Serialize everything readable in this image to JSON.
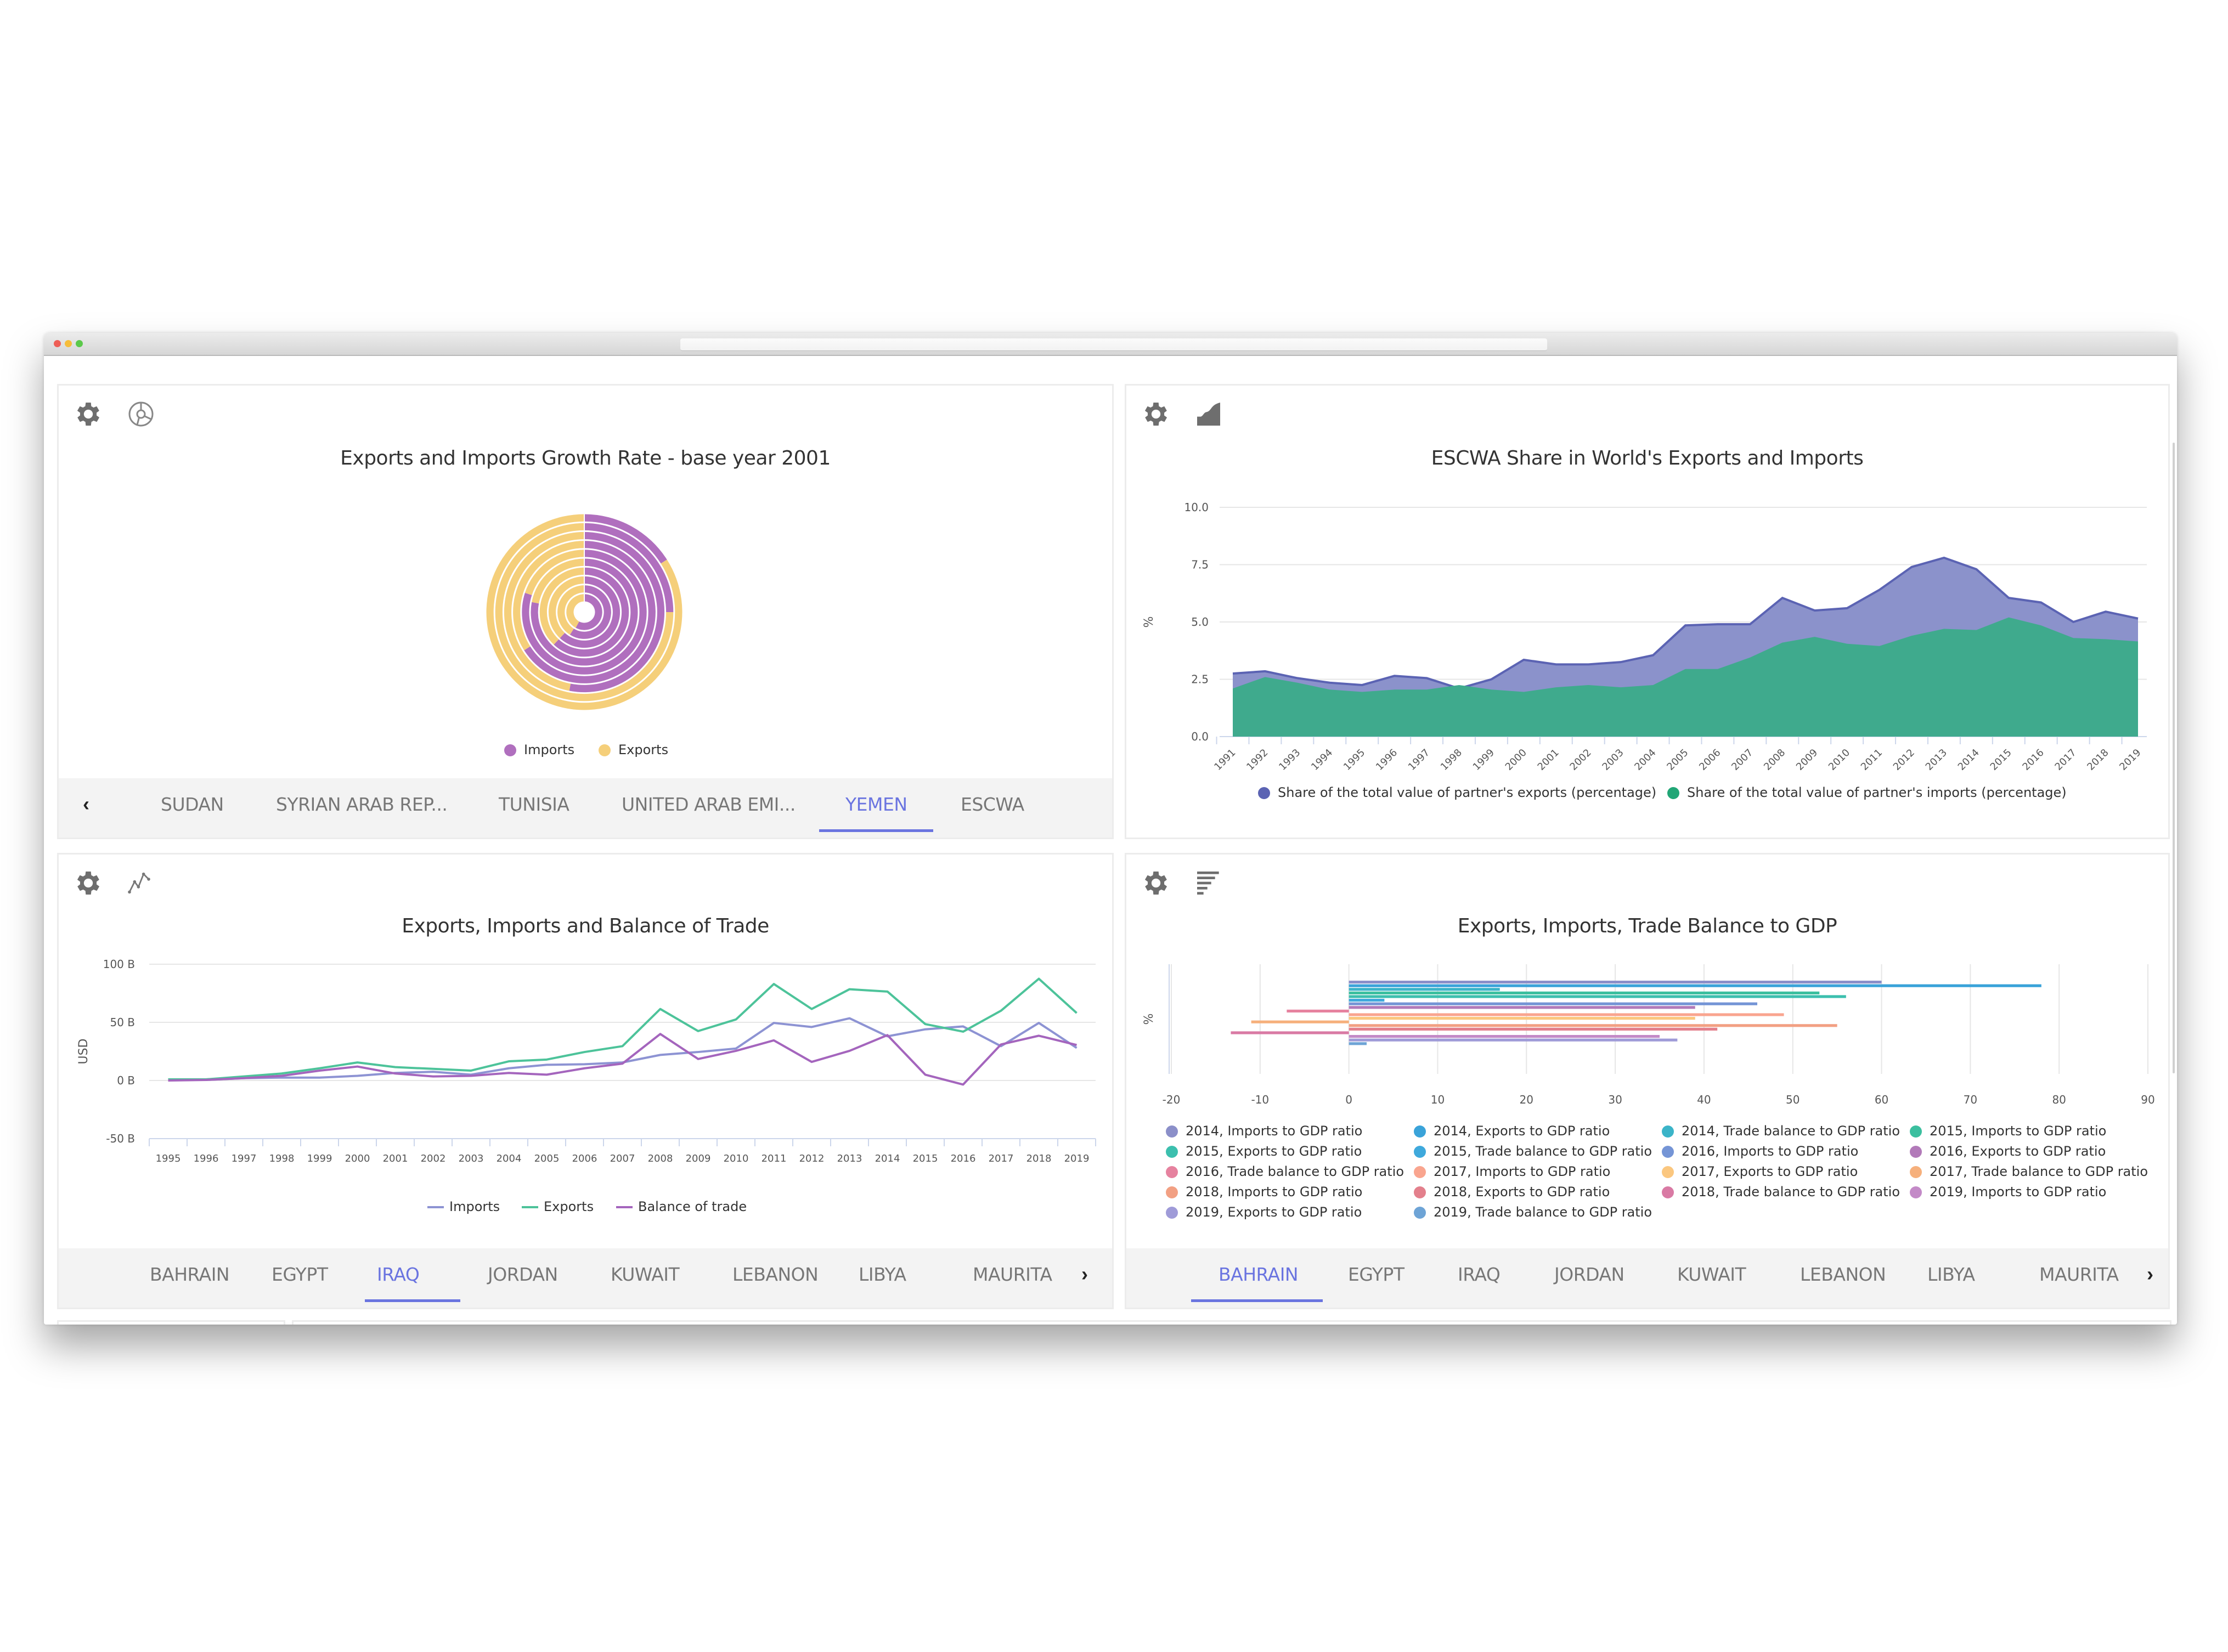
{
  "window": {
    "dots": [
      "#ee5e56",
      "#f6bd3b",
      "#5bc94a"
    ],
    "address_text": ""
  },
  "colors": {
    "accent": "#6a74e0",
    "icon_gray": "#6e6e6e",
    "tab_gray": "#777777",
    "imports_purple": "#b06fbe",
    "exports_yellow": "#f5cf7a",
    "area_exports": "#8b92cb",
    "area_exports_line": "#5b63b3",
    "area_imports": "#3faa8d",
    "line_imports": "#8d93d3",
    "line_exports": "#4dc39a",
    "line_balance": "#a465bd"
  },
  "panels": {
    "growth": {
      "icons": [
        "gear-icon",
        "polar-chart-icon"
      ],
      "title": "Exports and Imports Growth Rate - base year 2001",
      "legend": [
        {
          "label": "Imports",
          "color": "#b06fbe"
        },
        {
          "label": "Exports",
          "color": "#f5cf7a"
        }
      ],
      "tabs": {
        "prev_arrow": "‹",
        "items": [
          "SUDAN",
          "SYRIAN ARAB REP...",
          "TUNISIA",
          "UNITED ARAB EMI...",
          "YEMEN",
          "ESCWA"
        ],
        "active": "YEMEN"
      }
    },
    "share": {
      "icons": [
        "gear-icon",
        "area-chart-icon"
      ],
      "title": "ESCWA Share in World's Exports and Imports",
      "legend": [
        {
          "label": "Share of the total value of partner's exports (percentage)",
          "color": "#5b63b3"
        },
        {
          "label": "Share of the total value of partner's imports (percentage)",
          "color": "#21a676"
        }
      ]
    },
    "trade": {
      "icons": [
        "gear-icon",
        "line-chart-icon"
      ],
      "title": "Exports, Imports and Balance of Trade",
      "legend": [
        {
          "label": "Imports",
          "color": "#8d93d3"
        },
        {
          "label": "Exports",
          "color": "#4dc39a"
        },
        {
          "label": "Balance of trade",
          "color": "#a465bd"
        }
      ],
      "tabs": {
        "next_arrow": "›",
        "items": [
          "BAHRAIN",
          "EGYPT",
          "IRAQ",
          "JORDAN",
          "KUWAIT",
          "LEBANON",
          "LIBYA",
          "MAURITA"
        ],
        "active": "IRAQ"
      }
    },
    "gdp": {
      "icons": [
        "gear-icon",
        "bar-chart-icon"
      ],
      "title": "Exports, Imports, Trade Balance to GDP",
      "tabs": {
        "next_arrow": "›",
        "items": [
          "BAHRAIN",
          "EGYPT",
          "IRAQ",
          "JORDAN",
          "KUWAIT",
          "LEBANON",
          "LIBYA",
          "MAURITA"
        ],
        "active": "BAHRAIN"
      }
    }
  },
  "chart_data": [
    {
      "id": "growth",
      "type": "pie",
      "subtype": "concentric-rings",
      "title": "Exports and Imports Growth Rate - base year 2001",
      "rings_inner_to_outer_imports_share": [
        0.58,
        0.59,
        0.62,
        0.62,
        0.78,
        0.8,
        0.66,
        0.53,
        0.25,
        0.16
      ],
      "series": [
        {
          "name": "Imports",
          "color": "#b06fbe"
        },
        {
          "name": "Exports",
          "color": "#f5cf7a"
        }
      ],
      "legend": "bottom"
    },
    {
      "id": "share",
      "type": "area",
      "title": "ESCWA Share in World's Exports and Imports",
      "xlabel": "",
      "ylabel": "%",
      "ylim": [
        0,
        10
      ],
      "yticks": [
        "0.0",
        "2.5",
        "5.0",
        "7.5",
        "10.0"
      ],
      "x": [
        1991,
        1992,
        1993,
        1994,
        1995,
        1996,
        1997,
        1998,
        1999,
        2000,
        2001,
        2002,
        2003,
        2004,
        2005,
        2006,
        2007,
        2008,
        2009,
        2010,
        2011,
        2012,
        2013,
        2014,
        2015,
        2016,
        2017,
        2018,
        2019
      ],
      "series": [
        {
          "name": "Share of the total value of partner's exports (percentage)",
          "color": "#8b92cb",
          "values": [
            2.75,
            2.85,
            2.55,
            2.35,
            2.25,
            2.65,
            2.55,
            2.1,
            2.5,
            3.35,
            3.15,
            3.15,
            3.25,
            3.55,
            4.85,
            4.9,
            4.9,
            6.05,
            5.5,
            5.6,
            6.4,
            7.4,
            7.8,
            7.3,
            6.05,
            5.85,
            5.0,
            5.45,
            5.15
          ]
        },
        {
          "name": "Share of the total value of partner's imports (percentage)",
          "color": "#3faa8d",
          "values": [
            2.1,
            2.6,
            2.35,
            2.05,
            1.95,
            2.05,
            2.05,
            2.25,
            2.05,
            1.95,
            2.15,
            2.25,
            2.15,
            2.25,
            2.95,
            2.95,
            3.45,
            4.1,
            4.35,
            4.05,
            3.95,
            4.4,
            4.7,
            4.65,
            5.2,
            4.85,
            4.3,
            4.25,
            4.15
          ]
        }
      ],
      "grid": true,
      "legend": "bottom"
    },
    {
      "id": "trade",
      "type": "line",
      "title": "Exports, Imports and Balance of Trade",
      "xlabel": "",
      "ylabel": "USD",
      "ylim": [
        -50,
        100
      ],
      "yticks": [
        "-50 B",
        "0 B",
        "50 B",
        "100 B"
      ],
      "ytick_values": [
        -50,
        0,
        50,
        100
      ],
      "x": [
        1995,
        1996,
        1997,
        1998,
        1999,
        2000,
        2001,
        2002,
        2003,
        2004,
        2005,
        2006,
        2007,
        2008,
        2009,
        2010,
        2011,
        2012,
        2013,
        2014,
        2015,
        2016,
        2017,
        2018,
        2019
      ],
      "series": [
        {
          "name": "Imports",
          "color": "#8d93d3",
          "values": [
            0.5,
            0.5,
            2,
            2.5,
            2.5,
            4,
            6.5,
            7.5,
            5,
            10.5,
            13.5,
            14,
            15.5,
            22,
            24.5,
            27.5,
            49.5,
            46,
            53.5,
            38,
            44,
            46.5,
            29.5,
            49.5,
            28
          ]
        },
        {
          "name": "Exports",
          "color": "#4dc39a",
          "values": [
            1,
            1,
            3.5,
            6,
            10.5,
            15.5,
            11.5,
            10,
            8.5,
            16.5,
            18,
            24.5,
            29.5,
            61.5,
            42.5,
            52.5,
            83,
            61.5,
            78.5,
            76.5,
            48.5,
            42,
            60,
            87.5,
            58
          ]
        },
        {
          "name": "Balance of trade",
          "color": "#a465bd",
          "values": [
            0,
            0.5,
            2,
            4,
            8.5,
            12,
            6,
            3.5,
            4,
            6.5,
            5,
            10.5,
            14.5,
            40,
            18.5,
            25.5,
            34.5,
            16,
            25.5,
            39,
            5,
            -3.5,
            31,
            38.5,
            30.5
          ]
        }
      ],
      "grid": true,
      "legend": "bottom"
    },
    {
      "id": "gdp",
      "type": "bar",
      "orientation": "horizontal",
      "title": "Exports, Imports, Trade Balance to GDP",
      "xlabel": "",
      "ylabel": "%",
      "xlim": [
        -20,
        90
      ],
      "xticks": [
        -20,
        -10,
        0,
        10,
        20,
        30,
        40,
        50,
        60,
        70,
        80,
        90
      ],
      "series": [
        {
          "name": "2014, Imports to GDP ratio",
          "color": "#8b8fc9",
          "value": 60
        },
        {
          "name": "2014, Exports to GDP ratio",
          "color": "#3aa3d9",
          "value": 78
        },
        {
          "name": "2014, Trade balance to GDP ratio",
          "color": "#3bb4c8",
          "value": 17
        },
        {
          "name": "2015, Imports to GDP ratio",
          "color": "#3bbf9f",
          "value": 53
        },
        {
          "name": "2015, Exports to GDP ratio",
          "color": "#3cbfae",
          "value": 56
        },
        {
          "name": "2015, Trade balance to GDP ratio",
          "color": "#3fa9dc",
          "value": 4
        },
        {
          "name": "2016, Imports to GDP ratio",
          "color": "#7595d6",
          "value": 46
        },
        {
          "name": "2016, Exports to GDP ratio",
          "color": "#b27ab9",
          "value": 39
        },
        {
          "name": "2016, Trade balance to GDP ratio",
          "color": "#e6829f",
          "value": -7
        },
        {
          "name": "2017, Imports to GDP ratio",
          "color": "#f9a58f",
          "value": 49
        },
        {
          "name": "2017, Exports to GDP ratio",
          "color": "#fbc77f",
          "value": 39
        },
        {
          "name": "2017, Trade balance to GDP ratio",
          "color": "#f6b07c",
          "value": -11
        },
        {
          "name": "2018, Imports to GDP ratio",
          "color": "#f2a083",
          "value": 55
        },
        {
          "name": "2018, Exports to GDP ratio",
          "color": "#e3808c",
          "value": 41.5
        },
        {
          "name": "2018, Trade balance to GDP ratio",
          "color": "#d97aa4",
          "value": -13.3
        },
        {
          "name": "2019, Imports to GDP ratio",
          "color": "#c38ac7",
          "value": 35
        },
        {
          "name": "2019, Exports to GDP ratio",
          "color": "#9f9bd8",
          "value": 37
        },
        {
          "name": "2019, Trade balance to GDP ratio",
          "color": "#6ea4d6",
          "value": 2
        }
      ],
      "grid": true,
      "legend": "bottom"
    }
  ]
}
